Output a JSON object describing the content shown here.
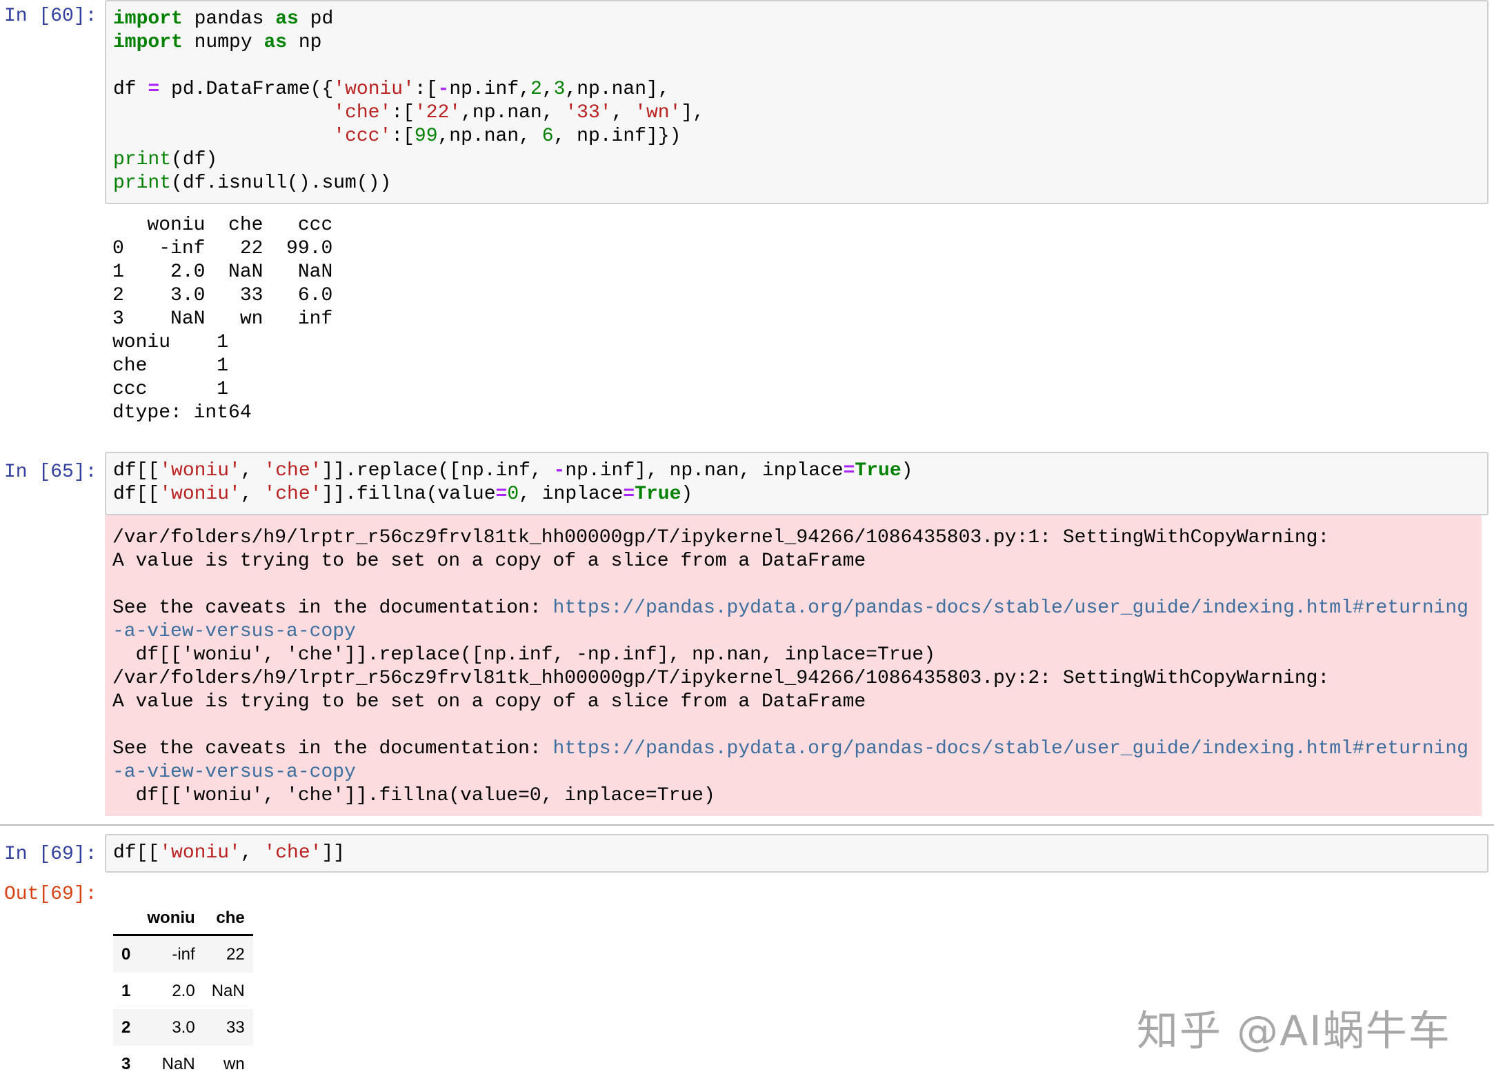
{
  "cells": [
    {
      "prompt": "In [60]:",
      "code_lines": [
        [
          {
            "t": "import",
            "c": "kw"
          },
          {
            "t": " pandas "
          },
          {
            "t": "as",
            "c": "kw"
          },
          {
            "t": " pd"
          }
        ],
        [
          {
            "t": "import",
            "c": "kw"
          },
          {
            "t": " numpy "
          },
          {
            "t": "as",
            "c": "kw"
          },
          {
            "t": " np"
          }
        ],
        [],
        [
          {
            "t": "df "
          },
          {
            "t": "=",
            "c": "op"
          },
          {
            "t": " pd.DataFrame({"
          },
          {
            "t": "'woniu'",
            "c": "str"
          },
          {
            "t": ":["
          },
          {
            "t": "-",
            "c": "op"
          },
          {
            "t": "np.inf,"
          },
          {
            "t": "2",
            "c": "num"
          },
          {
            "t": ","
          },
          {
            "t": "3",
            "c": "num"
          },
          {
            "t": ",np.nan],"
          }
        ],
        [
          {
            "t": "                   "
          },
          {
            "t": "'che'",
            "c": "str"
          },
          {
            "t": ":["
          },
          {
            "t": "'22'",
            "c": "str"
          },
          {
            "t": ",np.nan, "
          },
          {
            "t": "'33'",
            "c": "str"
          },
          {
            "t": ", "
          },
          {
            "t": "'wn'",
            "c": "str"
          },
          {
            "t": "],"
          }
        ],
        [
          {
            "t": "                   "
          },
          {
            "t": "'ccc'",
            "c": "str"
          },
          {
            "t": ":["
          },
          {
            "t": "99",
            "c": "num"
          },
          {
            "t": ",np.nan, "
          },
          {
            "t": "6",
            "c": "num"
          },
          {
            "t": ", np.inf]})"
          }
        ],
        [
          {
            "t": "print",
            "c": "bi"
          },
          {
            "t": "(df)"
          }
        ],
        [
          {
            "t": "print",
            "c": "bi"
          },
          {
            "t": "(df.isnull().sum())"
          }
        ]
      ],
      "stdout_lines": [
        "   woniu  che   ccc",
        "0   -inf   22  99.0",
        "1    2.0  NaN   NaN",
        "2    3.0   33   6.0",
        "3    NaN   wn   inf",
        "woniu    1",
        "che      1",
        "ccc      1",
        "dtype: int64"
      ]
    },
    {
      "prompt": "In [65]:",
      "code_lines": [
        [
          {
            "t": "df[["
          },
          {
            "t": "'woniu'",
            "c": "str"
          },
          {
            "t": ", "
          },
          {
            "t": "'che'",
            "c": "str"
          },
          {
            "t": "]].replace([np.inf, "
          },
          {
            "t": "-",
            "c": "op"
          },
          {
            "t": "np.inf], np.nan, inplace"
          },
          {
            "t": "=",
            "c": "op"
          },
          {
            "t": "True",
            "c": "kw"
          },
          {
            "t": ")"
          }
        ],
        [
          {
            "t": "df[["
          },
          {
            "t": "'woniu'",
            "c": "str"
          },
          {
            "t": ", "
          },
          {
            "t": "'che'",
            "c": "str"
          },
          {
            "t": "]].fillna(value"
          },
          {
            "t": "=",
            "c": "op"
          },
          {
            "t": "0",
            "c": "num"
          },
          {
            "t": ", inplace"
          },
          {
            "t": "=",
            "c": "op"
          },
          {
            "t": "True",
            "c": "kw"
          },
          {
            "t": ")"
          }
        ]
      ],
      "stderr_lines": [
        [
          {
            "t": "/var/folders/h9/lrptr_r56cz9frvl81tk_hh00000gp/T/ipykernel_94266/1086435803.py:1: SettingWithCopyWarning:"
          }
        ],
        [
          {
            "t": "A value is trying to be set on a copy of a slice from a DataFrame"
          }
        ],
        [],
        [
          {
            "t": "See the caveats in the documentation: "
          },
          {
            "t": "https://pandas.pydata.org/pandas-docs/stable/user_guide/indexing.html#returning",
            "c": "link"
          }
        ],
        [
          {
            "t": "-a-view-versus-a-copy",
            "c": "link"
          }
        ],
        [
          {
            "t": "  df[['woniu', 'che']].replace([np.inf, -np.inf], np.nan, inplace=True)"
          }
        ],
        [
          {
            "t": "/var/folders/h9/lrptr_r56cz9frvl81tk_hh00000gp/T/ipykernel_94266/1086435803.py:2: SettingWithCopyWarning:"
          }
        ],
        [
          {
            "t": "A value is trying to be set on a copy of a slice from a DataFrame"
          }
        ],
        [],
        [
          {
            "t": "See the caveats in the documentation: "
          },
          {
            "t": "https://pandas.pydata.org/pandas-docs/stable/user_guide/indexing.html#returning",
            "c": "link"
          }
        ],
        [
          {
            "t": "-a-view-versus-a-copy",
            "c": "link"
          }
        ],
        [
          {
            "t": "  df[['woniu', 'che']].fillna(value=0, inplace=True)"
          }
        ]
      ]
    },
    {
      "prompt": "In [69]:",
      "code_lines": [
        [
          {
            "t": "df[["
          },
          {
            "t": "'woniu'",
            "c": "str"
          },
          {
            "t": ", "
          },
          {
            "t": "'che'",
            "c": "str"
          },
          {
            "t": "]]"
          }
        ]
      ],
      "out_prompt": "Out[69]:",
      "table": {
        "columns": [
          "",
          "woniu",
          "che"
        ],
        "rows": [
          {
            "index": "0",
            "values": [
              "-inf",
              "22"
            ]
          },
          {
            "index": "1",
            "values": [
              "2.0",
              "NaN"
            ]
          },
          {
            "index": "2",
            "values": [
              "3.0",
              "33"
            ]
          },
          {
            "index": "3",
            "values": [
              "NaN",
              "wn"
            ]
          }
        ]
      }
    }
  ],
  "watermark": "知乎 @AI蜗牛车",
  "colors": {
    "prompt_in": "#303F9F",
    "prompt_out": "#D84315",
    "keyword": "#008000",
    "string": "#BA2121",
    "operator": "#AA22FF",
    "link": "#3d6e9e",
    "stderr_bg": "#fddcdf"
  }
}
